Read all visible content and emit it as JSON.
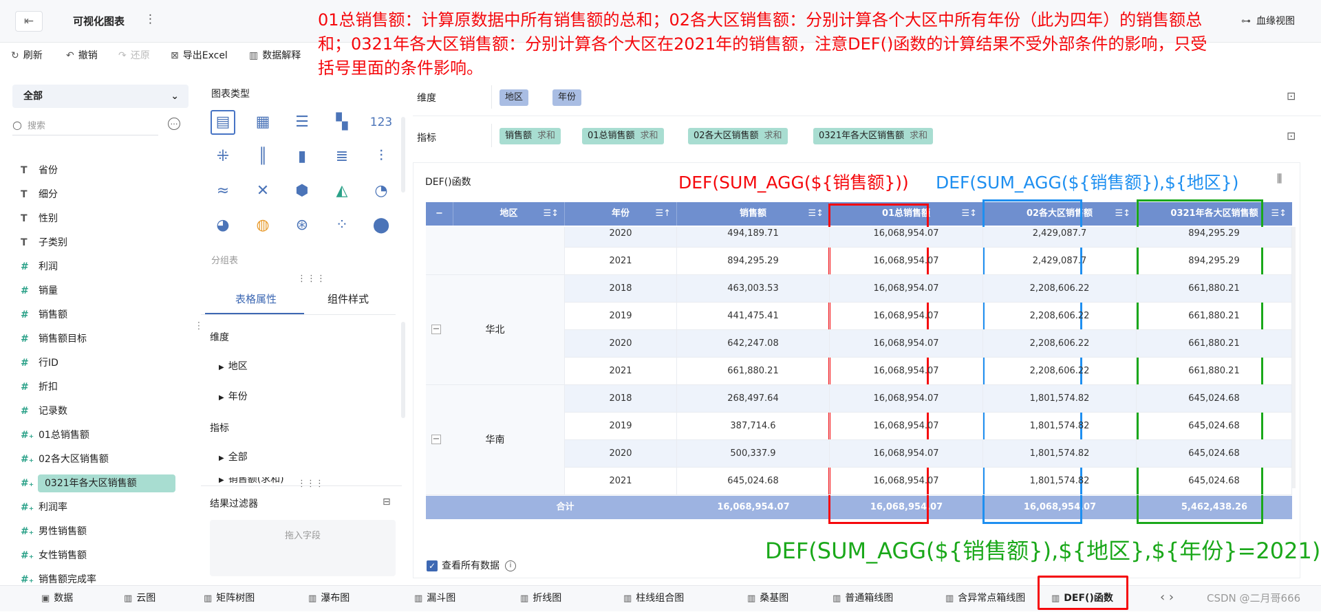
{
  "topbar": {
    "back_icon": "exit-icon",
    "title": "可视化图表",
    "more": "⋮",
    "lineage": "血缘视图"
  },
  "toolbar": {
    "refresh": "刷新",
    "undo": "撤销",
    "redo": "还原",
    "export": "导出Excel",
    "explain": "数据解释"
  },
  "annotation": "01总销售额：计算原数据中所有销售额的总和；02各大区销售额：分别计算各个大区中所有年份（此为四年）的销售额总和；0321年各大区销售额：分别计算各个大区在2021年的销售额，注意DEF()函数的计算结果不受外部条件的影响，只受括号里面的条件影响。",
  "left": {
    "select": "全部",
    "search_placeholder": "搜索",
    "fields": [
      {
        "type": "T",
        "label": "省份"
      },
      {
        "type": "T",
        "label": "细分"
      },
      {
        "type": "T",
        "label": "性别"
      },
      {
        "type": "T",
        "label": "子类别"
      },
      {
        "type": "#",
        "label": "利润"
      },
      {
        "type": "#",
        "label": "销量"
      },
      {
        "type": "#",
        "label": "销售额"
      },
      {
        "type": "#",
        "label": "销售额目标"
      },
      {
        "type": "#",
        "label": "行ID"
      },
      {
        "type": "#",
        "label": "折扣"
      },
      {
        "type": "#",
        "label": "记录数"
      },
      {
        "type": "#+",
        "label": "01总销售额"
      },
      {
        "type": "#+",
        "label": "02各大区销售额"
      },
      {
        "type": "#+",
        "label": "0321年各大区销售额"
      },
      {
        "type": "#+",
        "label": "利润率"
      },
      {
        "type": "#+",
        "label": "男性销售额"
      },
      {
        "type": "#+",
        "label": "女性销售额"
      },
      {
        "type": "#+",
        "label": "销售额完成率"
      }
    ]
  },
  "mid": {
    "chart_type_label": "图表类型",
    "group_table": "分组表",
    "tab_table": "表格属性",
    "tab_style": "组件样式",
    "dim_title": "维度",
    "dim_region": "地区",
    "dim_year": "年份",
    "metric_title": "指标",
    "metric_all": "全部",
    "metric_partial": "销售额(求和)",
    "filter_title": "结果过滤器",
    "drop_hint": "拖入字段"
  },
  "shelf": {
    "dim_label": "维度",
    "metric_label": "指标",
    "dims": [
      "地区",
      "年份"
    ],
    "metrics": [
      {
        "name": "销售额",
        "agg": "求和"
      },
      {
        "name": "01总销售额",
        "agg": "求和"
      },
      {
        "name": "02各大区销售额",
        "agg": "求和"
      },
      {
        "name": "0321年各大区销售额",
        "agg": "求和"
      }
    ]
  },
  "card": {
    "title": "DEF()函数",
    "formula_total": "DEF(SUM_AGG(${销售额}))",
    "formula_region": "DEF(SUM_AGG(${销售额}),${地区})",
    "formula_region_year": "DEF(SUM_AGG(${销售额}),${地区},${年份}=2021)",
    "view_all": "查看所有数据"
  },
  "table": {
    "headers": [
      "地区",
      "年份",
      "销售额",
      "01总销售额",
      "02各大区销售额",
      "0321年各大区销售额"
    ],
    "collapse": "−",
    "rows": [
      {
        "region": "",
        "year": "2020",
        "sales": "494,189.71",
        "total": "16,068,954.07",
        "region_sum": "2,429,087.7",
        "y2021": "894,295.29"
      },
      {
        "region": "",
        "year": "2021",
        "sales": "894,295.29",
        "total": "16,068,954.07",
        "region_sum": "2,429,087.7",
        "y2021": "894,295.29"
      },
      {
        "region": "华北",
        "year": "2018",
        "sales": "463,003.53",
        "total": "16,068,954.07",
        "region_sum": "2,208,606.22",
        "y2021": "661,880.21"
      },
      {
        "region": "华北",
        "year": "2019",
        "sales": "441,475.41",
        "total": "16,068,954.07",
        "region_sum": "2,208,606.22",
        "y2021": "661,880.21"
      },
      {
        "region": "华北",
        "year": "2020",
        "sales": "642,247.08",
        "total": "16,068,954.07",
        "region_sum": "2,208,606.22",
        "y2021": "661,880.21"
      },
      {
        "region": "华北",
        "year": "2021",
        "sales": "661,880.21",
        "total": "16,068,954.07",
        "region_sum": "2,208,606.22",
        "y2021": "661,880.21"
      },
      {
        "region": "华南",
        "year": "2018",
        "sales": "268,497.64",
        "total": "16,068,954.07",
        "region_sum": "1,801,574.82",
        "y2021": "645,024.68"
      },
      {
        "region": "华南",
        "year": "2019",
        "sales": "387,714.6",
        "total": "16,068,954.07",
        "region_sum": "1,801,574.82",
        "y2021": "645,024.68"
      },
      {
        "region": "华南",
        "year": "2020",
        "sales": "500,337.9",
        "total": "16,068,954.07",
        "region_sum": "1,801,574.82",
        "y2021": "645,024.68"
      },
      {
        "region": "华南",
        "year": "2021",
        "sales": "645,024.68",
        "total": "16,068,954.07",
        "region_sum": "1,801,574.82",
        "y2021": "645,024.68"
      }
    ],
    "total_row": {
      "label": "合计",
      "sales": "16,068,954.07",
      "total": "16,068,954.07",
      "region_sum": "16,068,954.07",
      "y2021": "5,462,438.26"
    }
  },
  "bottom_tabs": [
    "数据",
    "云图",
    "矩阵树图",
    "瀑布图",
    "漏斗图",
    "折线图",
    "柱线组合图",
    "桑基图",
    "普通箱线图",
    "含异常点箱线图",
    "DEF()函数"
  ],
  "watermark": "CSDN @二月哥666",
  "colors": {
    "annotation_red": "#f5080c",
    "blue_box": "#1e8ff0",
    "green_box": "#1aa81a",
    "header_blue": "#6f8fcf",
    "metric_pill": "#a8ddd1",
    "dim_pill": "#a9bde3"
  }
}
